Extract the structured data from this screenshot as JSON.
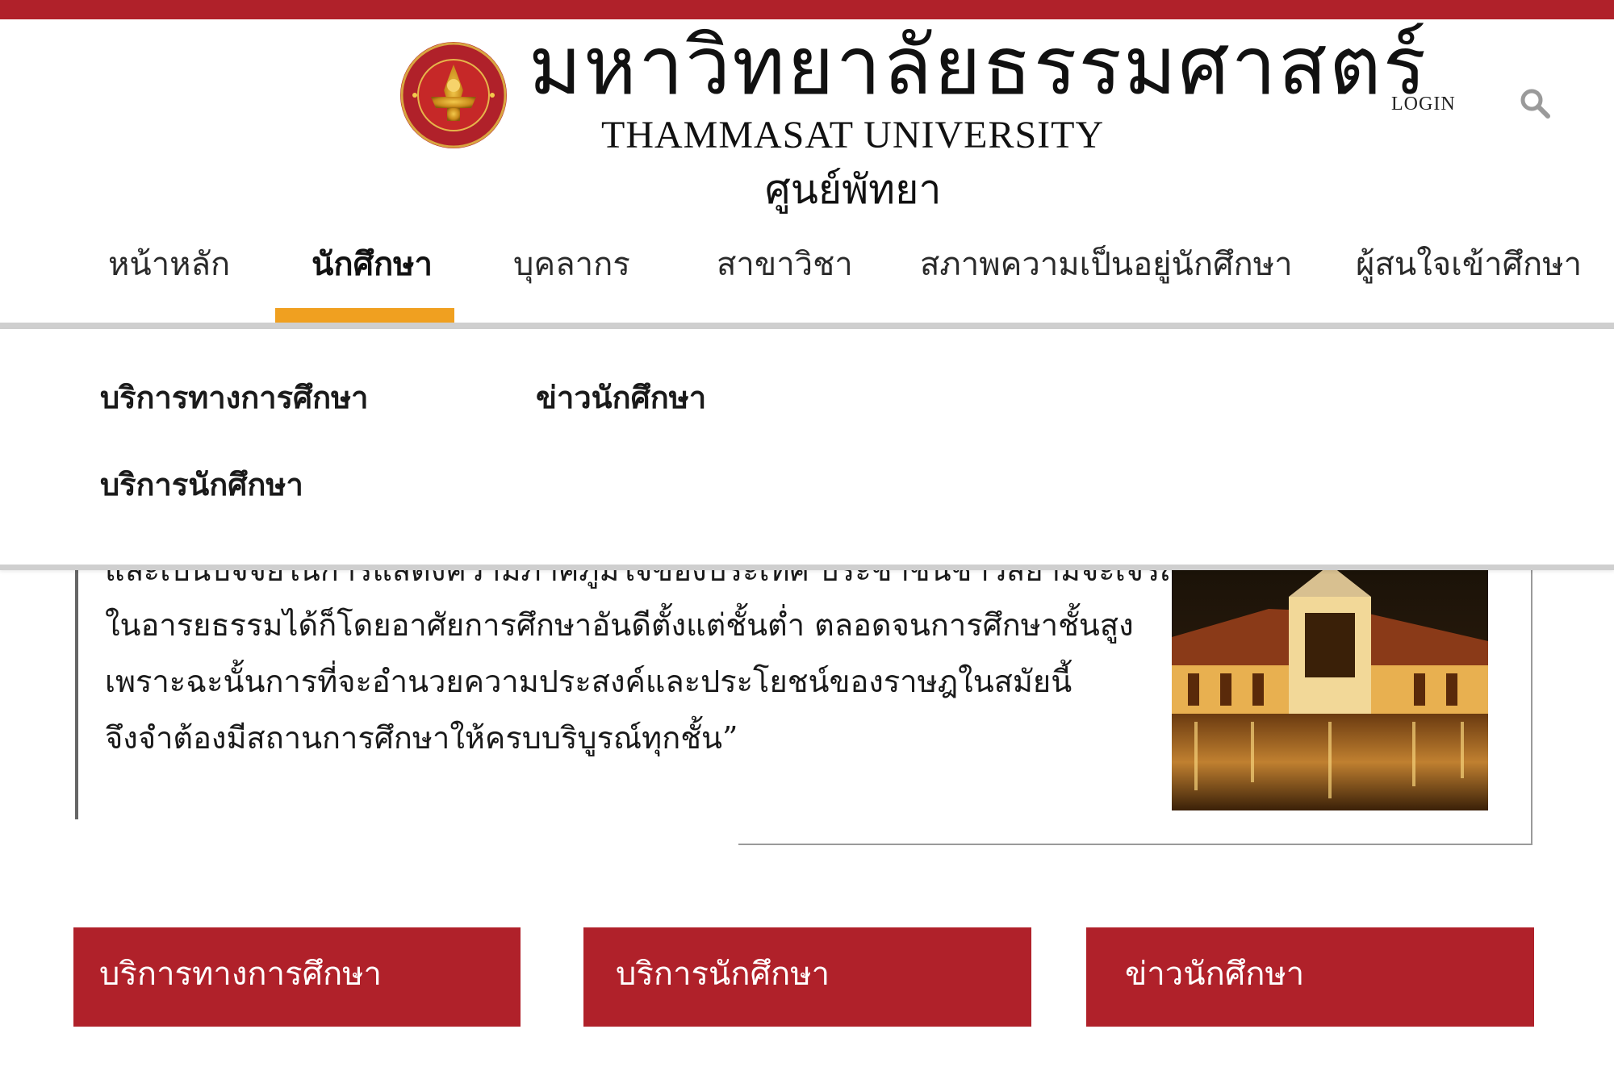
{
  "header": {
    "title_th": "มหาวิทยาลัยธรรมศาสตร์",
    "title_en": "THAMMASAT UNIVERSITY",
    "campus": "ศูนย์พัทยา",
    "login": "LOGIN",
    "logo_icon": "thammasat-seal-icon",
    "search_icon": "search-icon"
  },
  "nav": {
    "items": [
      {
        "label": "หน้าหลัก"
      },
      {
        "label": "นักศึกษา",
        "active": true
      },
      {
        "label": "บุคลากร"
      },
      {
        "label": "สาขาวิชา"
      },
      {
        "label": "สภาพความเป็นอยู่นักศึกษา"
      },
      {
        "label": "ผู้สนใจเข้าศึกษา"
      }
    ]
  },
  "dropdown": {
    "items": [
      {
        "label": "บริการทางการศึกษา"
      },
      {
        "label": "ข่าวนักศึกษา"
      },
      {
        "label": "บริการนักศึกษา"
      }
    ]
  },
  "quote": {
    "lines": [
      "และเป็นปัจจัยในการแสดงความภาคภูมิใจของประเทศ ประชาชนชาวสยามจะเจริญ",
      "ในอารยธรรมได้ก็โดยอาศัยการศึกษาอันดีตั้งแต่ชั้นต่ำ ตลอดจนการศึกษาชั้นสูง",
      "เพราะฉะนั้นการที่จะอำนวยความประสงค์และประโยชน์ของราษฎในสมัยนี้",
      "จึงจำต้องมีสถานการศึกษาให้ครบบริบูรณ์ทุกชั้น”"
    ]
  },
  "cards": [
    {
      "label": "บริการทางการศึกษา"
    },
    {
      "label": "บริการนักศึกษา"
    },
    {
      "label": "ข่าวนักศึกษา"
    }
  ],
  "colors": {
    "brand_red": "#b0212a",
    "accent_orange": "#f0a020",
    "rule_gray": "#cfcfcf"
  }
}
